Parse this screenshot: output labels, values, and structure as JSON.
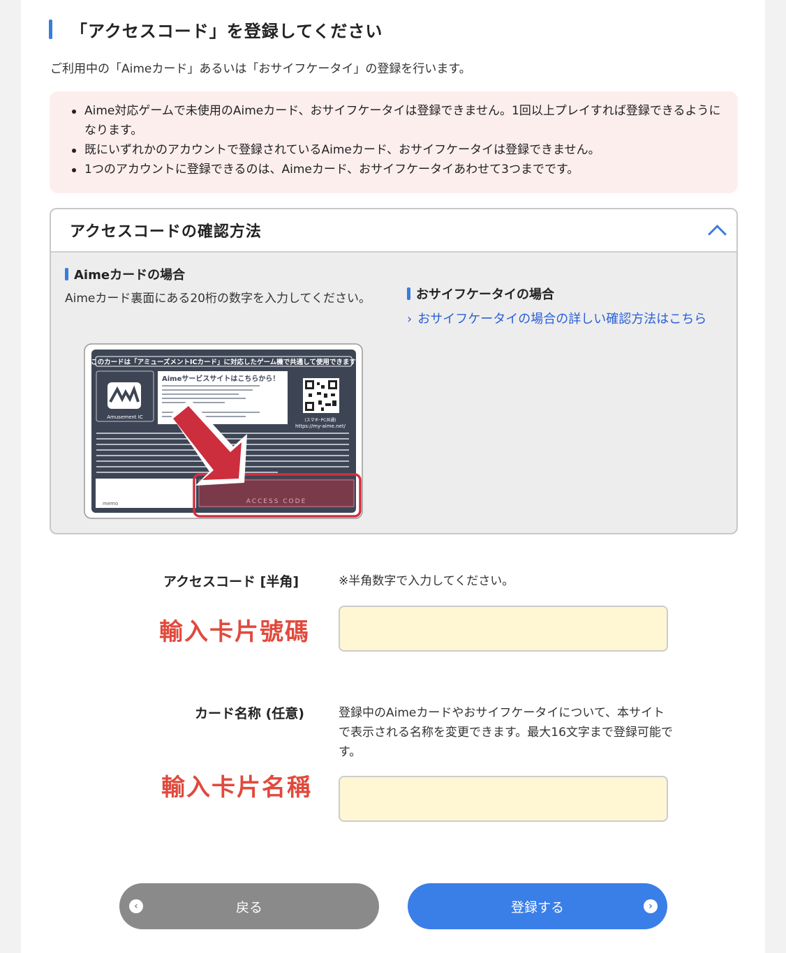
{
  "page": {
    "title": "「アクセスコード」を登録してください",
    "intro": "ご利用中の「Aimeカード」あるいは「おサイフケータイ」の登録を行います。"
  },
  "notice": {
    "items": [
      "Aime対応ゲームで未使用のAimeカード、おサイフケータイは登録できません。1回以上プレイすれば登録できるようになります。",
      "既にいずれかのアカウントで登録されているAimeカード、おサイフケータイは登録できません。",
      "1つのアカウントに登録できるのは、Aimeカード、おサイフケータイあわせて3つまでです。"
    ]
  },
  "accordion": {
    "title": "アクセスコードの確認方法",
    "left_heading": "Aimeカードの場合",
    "left_desc": "Aimeカード裏面にある20桁の数字を入力してください。",
    "right_heading": "おサイフケータイの場合",
    "right_link": "おサイフケータイの場合の詳しい確認方法はこちら"
  },
  "card_image": {
    "top_banner": "このカードは「アミューズメントICカード」に対応したゲーム機で共通して使用できます",
    "service_title": "Aimeサービスサイトはこちらから！",
    "logo_caption": "Amusement IC",
    "url": "https://my-aime.net/",
    "url_note": "(スマホ･PC共通)",
    "memo": "memo",
    "access_code": "ACCESS CODE"
  },
  "form": {
    "access_code_label": "アクセスコード [半角]",
    "access_code_hint": "※半角数字で入力してください。",
    "access_code_annotation": "輸入卡片號碼",
    "access_code_value": "",
    "card_name_label": "カード名称 (任意)",
    "card_name_hint": "登録中のAimeカードやおサイフケータイについて、本サイトで表示される名称を変更できます。最大16文字まで登録可能です。",
    "card_name_annotation": "輸入卡片名稱",
    "card_name_value": ""
  },
  "buttons": {
    "back": "戻る",
    "submit": "登録する"
  },
  "colors": {
    "accent": "#3a7cdc",
    "notice_bg": "#fdeeee",
    "input_bg": "#fff6d4",
    "annotation_red": "#e04a3d",
    "back_button": "#8a8a8a",
    "submit_button": "#3a7ee8"
  }
}
